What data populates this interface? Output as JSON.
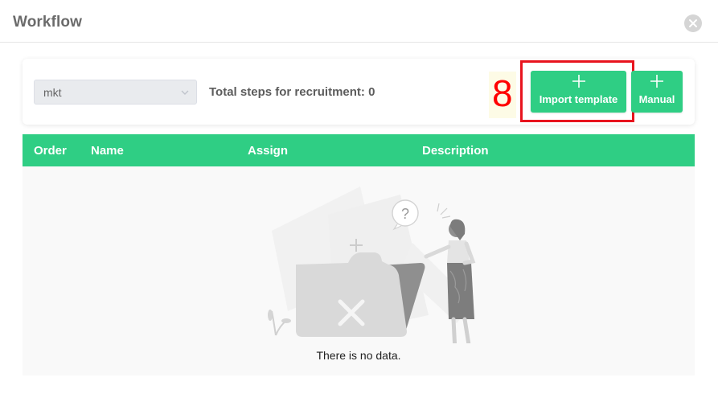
{
  "dialog": {
    "title": "Workflow",
    "close_icon": "close-circle-icon"
  },
  "toolbar": {
    "select": {
      "value": "mkt",
      "icon": "chevron-down-icon"
    },
    "total_label": "Total steps for recruitment: 0",
    "annotation_number": "8",
    "import_button": {
      "icon": "plus-icon",
      "label": "Import template"
    },
    "manual_button": {
      "icon": "plus-icon",
      "label": "Manual"
    }
  },
  "table": {
    "columns": [
      "Order",
      "Name",
      "Assign",
      "Description"
    ],
    "empty_text": "There is no data."
  },
  "colors": {
    "accent_green": "#2fce84",
    "annotation_red": "#e8141e"
  }
}
